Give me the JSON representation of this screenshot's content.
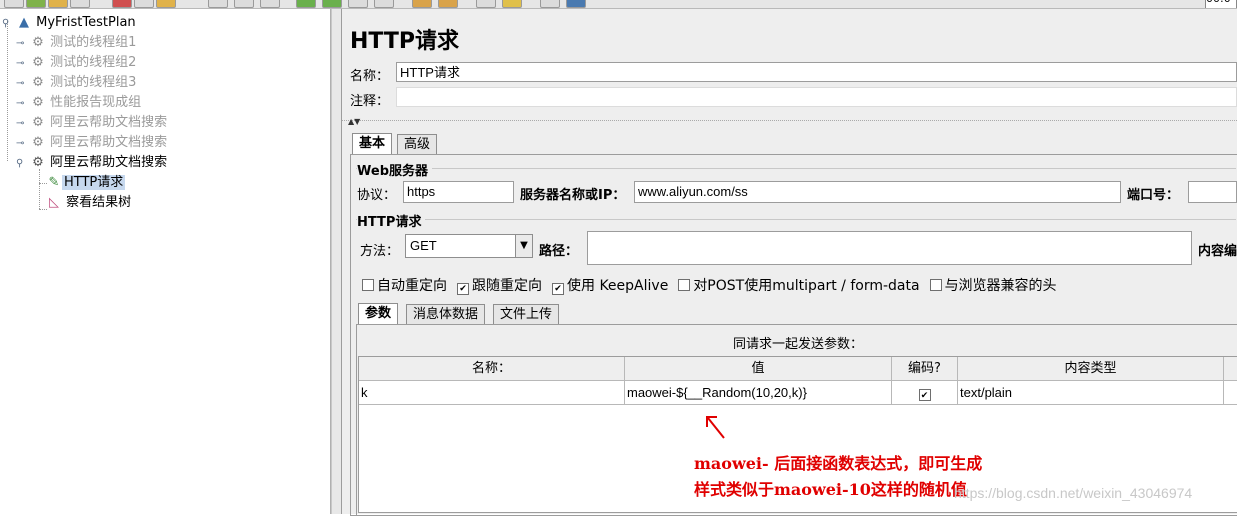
{
  "toolbar": {
    "zoom_value": "00:0"
  },
  "tree": {
    "root_label": "MyFristTestPlan",
    "items": [
      {
        "label": "测试的线程组1",
        "enabled": false
      },
      {
        "label": "测试的线程组2",
        "enabled": false
      },
      {
        "label": "测试的线程组3",
        "enabled": false
      },
      {
        "label": "性能报告现成组",
        "enabled": false
      },
      {
        "label": "阿里云帮助文档搜索",
        "enabled": false
      },
      {
        "label": "阿里云帮助文档搜索",
        "enabled": false
      },
      {
        "label": "阿里云帮助文档搜索",
        "enabled": true
      }
    ],
    "children": [
      {
        "label": "HTTP请求",
        "selected": true
      },
      {
        "label": "察看结果树",
        "selected": false
      }
    ]
  },
  "main": {
    "title": "HTTP请求",
    "name_label": "名称：",
    "name_value": "HTTP请求",
    "comment_label": "注释：",
    "comment_value": "",
    "tabs": [
      {
        "label": "基本",
        "active": true
      },
      {
        "label": "高级",
        "active": false
      }
    ],
    "web_server": {
      "group_title": "Web服务器",
      "protocol_label": "协议：",
      "protocol_value": "https",
      "server_label": "服务器名称或IP：",
      "server_value": "www.aliyun.com/ss",
      "port_label": "端口号：",
      "port_value": ""
    },
    "http_request": {
      "group_title": "HTTP请求",
      "method_label": "方法：",
      "method_value": "GET",
      "path_label": "路径：",
      "path_value": "",
      "content_encoding_label": "内容编"
    },
    "options": [
      {
        "label": "自动重定向",
        "checked": false
      },
      {
        "label": "跟随重定向",
        "checked": true
      },
      {
        "label": "使用 KeepAlive",
        "checked": true
      },
      {
        "label": "对POST使用multipart / form-data",
        "checked": false
      },
      {
        "label": "与浏览器兼容的头",
        "checked": false
      }
    ],
    "sub_tabs": [
      {
        "label": "参数",
        "active": true
      },
      {
        "label": "消息体数据",
        "active": false
      },
      {
        "label": "文件上传",
        "active": false
      }
    ],
    "params_table": {
      "caption": "同请求一起发送参数：",
      "columns": [
        "名称：",
        "值",
        "编码?",
        "内容类型"
      ],
      "rows": [
        {
          "name": "k",
          "value": "maowei-${__Random(10,20,k)}",
          "encode": true,
          "content_type": "text/plain"
        }
      ]
    }
  },
  "annotation": {
    "line1": "maowei- 后面接函数表达式，即可生成",
    "line2": "样式类似于maowei-10这样的随机值",
    "accent": "#e00000"
  },
  "watermark": "https://blog.csdn.net/weixin_43046974"
}
